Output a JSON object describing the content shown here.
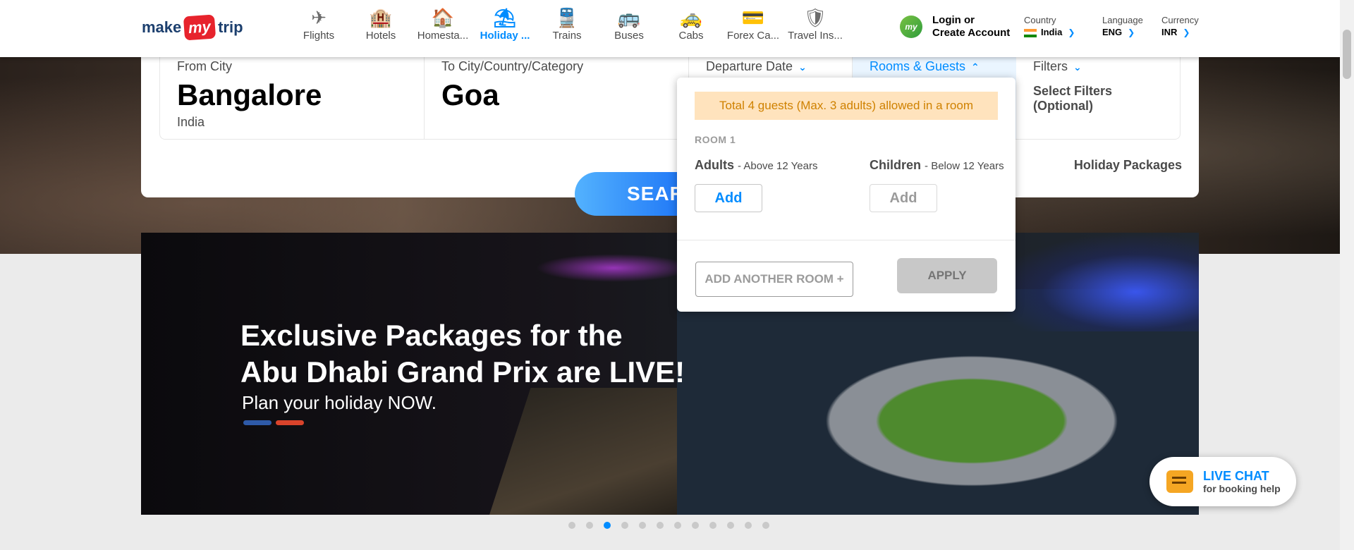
{
  "brand": {
    "make": "make",
    "my": "my",
    "trip": "trip"
  },
  "nav": [
    {
      "label": "Flights",
      "icon": "✈"
    },
    {
      "label": "Hotels",
      "icon": "🏨"
    },
    {
      "label": "Homesta...",
      "icon": "🏠"
    },
    {
      "label": "Holiday ...",
      "icon": "⛱"
    },
    {
      "label": "Trains",
      "icon": "🚆"
    },
    {
      "label": "Buses",
      "icon": "🚌"
    },
    {
      "label": "Cabs",
      "icon": "🚕"
    },
    {
      "label": "Forex Ca...",
      "icon": "💳"
    },
    {
      "label": "Travel Ins...",
      "icon": "🛡"
    }
  ],
  "login": {
    "avatar": "my",
    "line1": "Login or",
    "line2": "Create Account"
  },
  "prefs": {
    "country": {
      "label": "Country",
      "value": "India"
    },
    "language": {
      "label": "Language",
      "value": "ENG"
    },
    "currency": {
      "label": "Currency",
      "value": "INR"
    }
  },
  "search": {
    "from": {
      "label": "From City",
      "value": "Bangalore",
      "sub": "India"
    },
    "to": {
      "label": "To City/Country/Category",
      "value": "Goa"
    },
    "departure": {
      "label": "Departure Date"
    },
    "rooms": {
      "label": "Rooms & Guests"
    },
    "filters": {
      "label": "Filters",
      "line1": "Select Filters",
      "line2": "(Optional)"
    },
    "package_type": "Holiday Packages",
    "button": "SEARCH"
  },
  "rooms_popup": {
    "warning": "Total 4 guests (Max. 3 adults) allowed in a room",
    "room_title": "ROOM 1",
    "adults_label": "Adults",
    "adults_hint": "- Above 12 Years",
    "children_label": "Children",
    "children_hint": "- Below 12 Years",
    "add": "Add",
    "add_room": "ADD ANOTHER ROOM +",
    "apply": "APPLY"
  },
  "banner": {
    "headline_1": "Exclusive Packages for the",
    "headline_2": "Abu Dhabi Grand Prix are LIVE!",
    "sub": "Plan your holiday NOW.",
    "accent_colors": [
      "#2e5aa8",
      "#d9432b"
    ]
  },
  "carousel": {
    "count": 12,
    "active_index": 2
  },
  "livechat": {
    "title": "LIVE CHAT",
    "sub": "for booking help"
  },
  "colors": {
    "accent": "#008cff",
    "brand_red": "#e7232c",
    "warning_bg": "#ffe3bd",
    "warning_text": "#cf8100"
  }
}
